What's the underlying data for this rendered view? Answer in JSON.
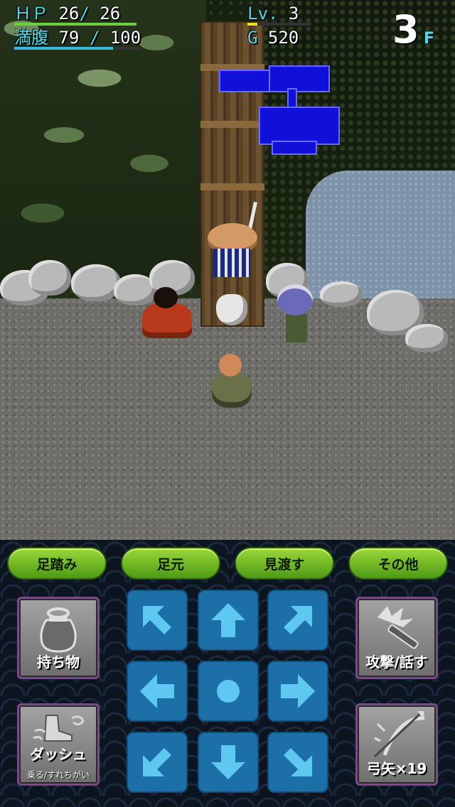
{
  "hud": {
    "hp_label": "ＨＰ",
    "hp_current": "26",
    "hp_sep": "/",
    "hp_max": "26",
    "fullness_label": "満腹",
    "fullness_current": "79",
    "fullness_sep": "/",
    "fullness_max": "100",
    "level_label": "Lv.",
    "level_value": "3",
    "gold_label": "G",
    "gold_value": "520",
    "floor_number": "3",
    "floor_suffix": "F",
    "hp_fraction": 1.0,
    "fullness_fraction": 0.79,
    "xp_fraction": 0.15,
    "colors": {
      "hp_bar": "#6bd03c",
      "fullness_bar": "#39b8e0",
      "xp_bar": "#e8e020",
      "label": "#4fd8e8"
    }
  },
  "actions": {
    "step_label": "足踏み",
    "underfoot_label": "足元",
    "lookaround_label": "見渡す",
    "other_label": "その他"
  },
  "side_buttons": {
    "inventory_label": "持ち物",
    "dash_label": "ダッシュ",
    "dash_sub": "乗る/すれちがい",
    "attack_label": "攻撃/話す",
    "arrows_label": "弓矢×19"
  },
  "dpad": {
    "up_left": "arrow-up-left-icon",
    "up": "arrow-up-icon",
    "up_right": "arrow-up-right-icon",
    "left": "arrow-left-icon",
    "center": "circle-icon",
    "right": "arrow-right-icon",
    "down_left": "arrow-down-left-icon",
    "down": "arrow-down-icon",
    "down_right": "arrow-down-right-icon"
  }
}
